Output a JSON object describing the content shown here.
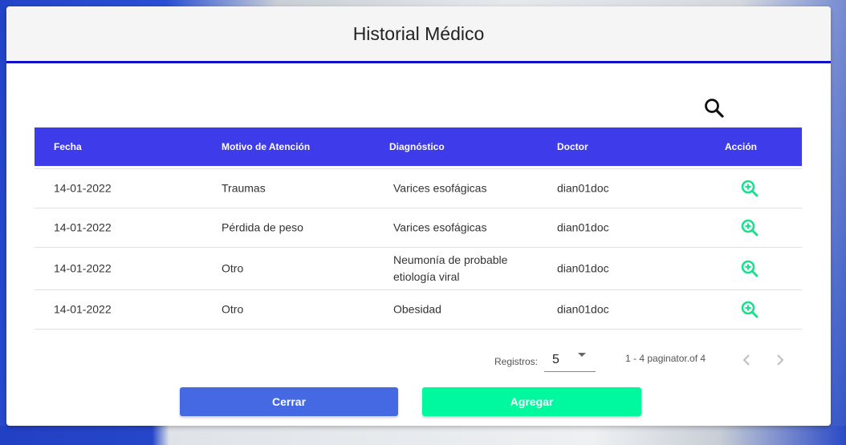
{
  "dialog": {
    "title": "Historial Médico"
  },
  "table": {
    "headers": [
      "Fecha",
      "Motivo de Atención",
      "Diagnóstico",
      "Doctor",
      "Acción"
    ],
    "rows": [
      {
        "fecha": "14-01-2022",
        "motivo": "Traumas",
        "diagnostico": "Varices esofágicas",
        "doctor": "dian01doc"
      },
      {
        "fecha": "14-01-2022",
        "motivo": "Pérdida de peso",
        "diagnostico": "Varices esofágicas",
        "doctor": "dian01doc"
      },
      {
        "fecha": "14-01-2022",
        "motivo": "Otro",
        "diagnostico": "Neumonía de probable etiología viral",
        "doctor": "dian01doc"
      },
      {
        "fecha": "14-01-2022",
        "motivo": "Otro",
        "diagnostico": "Obesidad",
        "doctor": "dian01doc"
      }
    ],
    "action_icon": "zoom-in-icon"
  },
  "paginator": {
    "label": "Registros:",
    "page_size": "5",
    "range": "1 - 4 paginator.of 4"
  },
  "buttons": {
    "close_label": "Cerrar",
    "add_label": "Agregar"
  },
  "colors": {
    "header_accent": "#1010c8",
    "table_header": "#3d3bea",
    "close_button": "#4469e2",
    "add_button": "#00f99e",
    "action_icon": "#19e08f"
  },
  "icons": {
    "search": "search-icon",
    "prev": "chevron-left-icon",
    "next": "chevron-right-icon"
  }
}
